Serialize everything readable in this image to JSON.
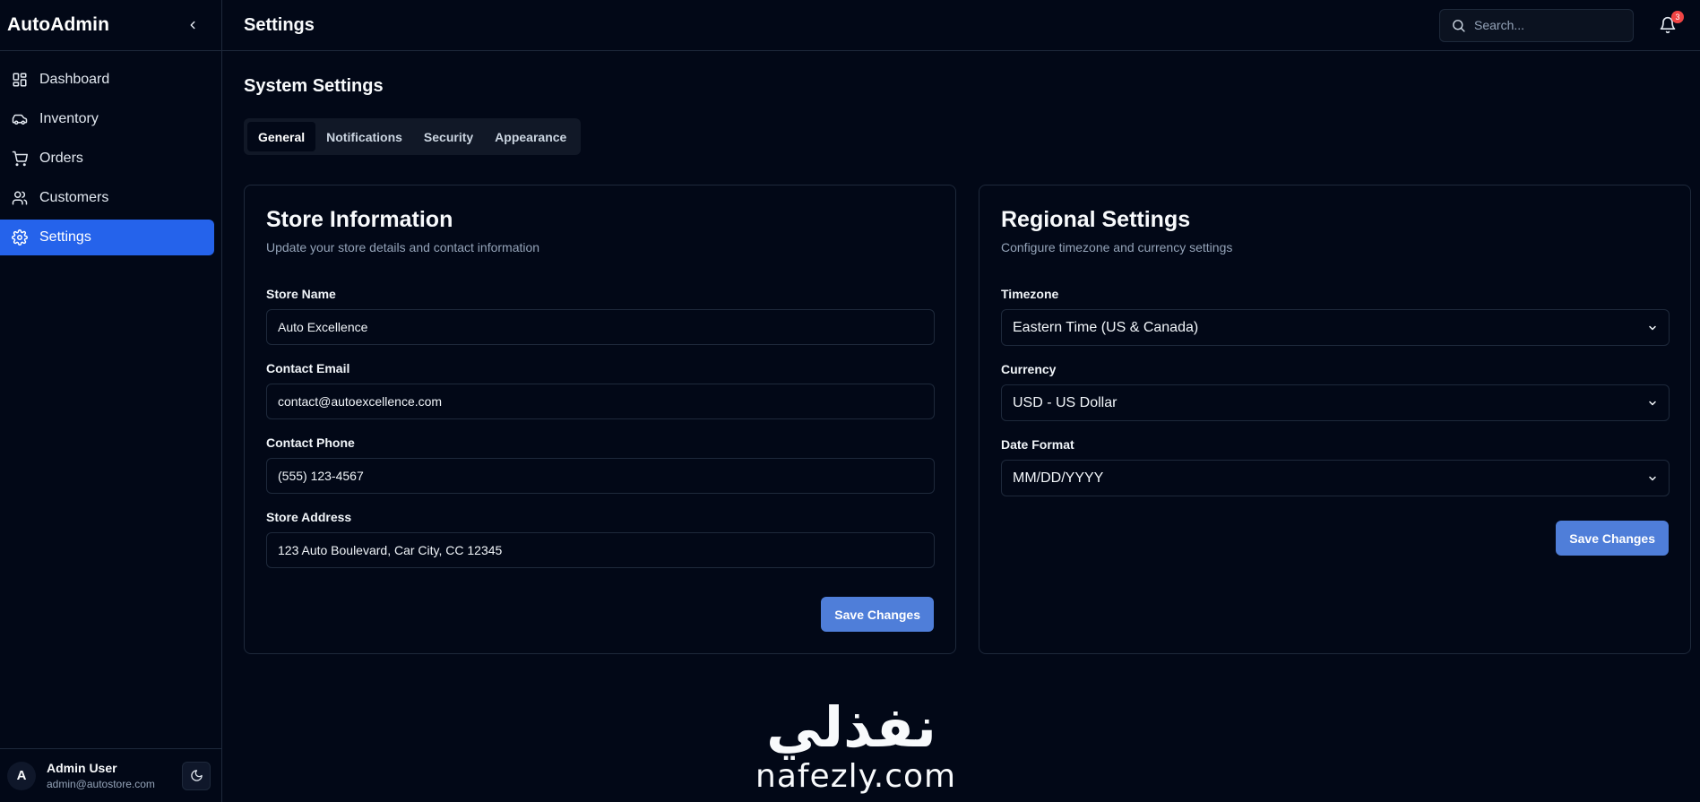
{
  "app": {
    "brand": "AutoAdmin"
  },
  "sidebar": {
    "items": [
      {
        "label": "Dashboard",
        "icon": "dashboard-icon"
      },
      {
        "label": "Inventory",
        "icon": "car-icon"
      },
      {
        "label": "Orders",
        "icon": "cart-icon"
      },
      {
        "label": "Customers",
        "icon": "users-icon"
      },
      {
        "label": "Settings",
        "icon": "gear-icon",
        "active": true
      }
    ],
    "user": {
      "initial": "A",
      "name": "Admin User",
      "email": "admin@autostore.com"
    }
  },
  "header": {
    "title": "Settings",
    "search_placeholder": "Search...",
    "notification_count": "3"
  },
  "main": {
    "heading": "System Settings",
    "tabs": [
      {
        "label": "General",
        "active": true
      },
      {
        "label": "Notifications"
      },
      {
        "label": "Security"
      },
      {
        "label": "Appearance"
      }
    ],
    "store": {
      "title": "Store Information",
      "subtitle": "Update your store details and contact information",
      "fields": [
        {
          "label": "Store Name",
          "value": "Auto Excellence"
        },
        {
          "label": "Contact Email",
          "value": "contact@autoexcellence.com"
        },
        {
          "label": "Contact Phone",
          "value": "(555) 123-4567"
        },
        {
          "label": "Store Address",
          "value": "123 Auto Boulevard, Car City, CC 12345"
        }
      ],
      "save_label": "Save Changes"
    },
    "regional": {
      "title": "Regional Settings",
      "subtitle": "Configure timezone and currency settings",
      "fields": [
        {
          "label": "Timezone",
          "value": "Eastern Time (US & Canada)"
        },
        {
          "label": "Currency",
          "value": "USD - US Dollar"
        },
        {
          "label": "Date Format",
          "value": "MM/DD/YYYY"
        }
      ],
      "save_label": "Save Changes"
    }
  },
  "watermark": {
    "arabic": "نفذلي",
    "latin": "nafezly.com"
  },
  "colors": {
    "accent": "#2563eb",
    "button": "#4f7ed9",
    "background": "#020817",
    "border": "#1e293b",
    "badge": "#ef4444"
  }
}
